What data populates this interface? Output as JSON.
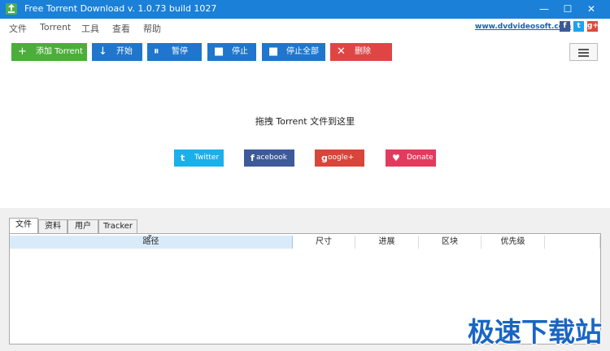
{
  "window": {
    "title": "Free Torrent Download v. 1.0.73 build 1027",
    "min_symbol": "—",
    "max_symbol": "☐",
    "close_symbol": "✕"
  },
  "menu": {
    "items": [
      "文件",
      "Torrent",
      "工具",
      "查看",
      "帮助"
    ],
    "site_link": "www.dvdvideosoft.com",
    "social": [
      "f",
      "t",
      "g+"
    ]
  },
  "toolbar": {
    "add": {
      "icon": "+",
      "label": "添加 Torrent"
    },
    "start": {
      "icon": "↓",
      "label": "开始"
    },
    "pause": {
      "icon": "⏸",
      "label": "暂停"
    },
    "stop": {
      "icon": "■",
      "label": "停止"
    },
    "stop_all": {
      "icon": "■",
      "label": "停止全部"
    },
    "delete": {
      "icon": "✕",
      "label": "删除"
    }
  },
  "drop_area": {
    "text": "拖拽 Torrent 文件到这里"
  },
  "share": {
    "twitter": {
      "icon": "t",
      "label": "Twitter"
    },
    "facebook": {
      "icon": "f",
      "label": "acebook"
    },
    "google": {
      "icon": "g",
      "label": "oogle+"
    },
    "donate": {
      "icon": "♥",
      "label": "Donate"
    }
  },
  "tabs": [
    "文件",
    "资料",
    "用户",
    "Tracker"
  ],
  "table": {
    "columns": [
      "路径",
      "尺寸",
      "进展",
      "区块",
      "优先级"
    ]
  },
  "watermark": "极速下载站",
  "colors": {
    "titlebar": "#1a80d8",
    "add_button": "#4cae3a",
    "action_button": "#1f76cc",
    "delete_button": "#e04545",
    "twitter": "#1ab0ea",
    "facebook": "#3d5a99",
    "google": "#d9453a",
    "donate": "#e23b5e"
  }
}
